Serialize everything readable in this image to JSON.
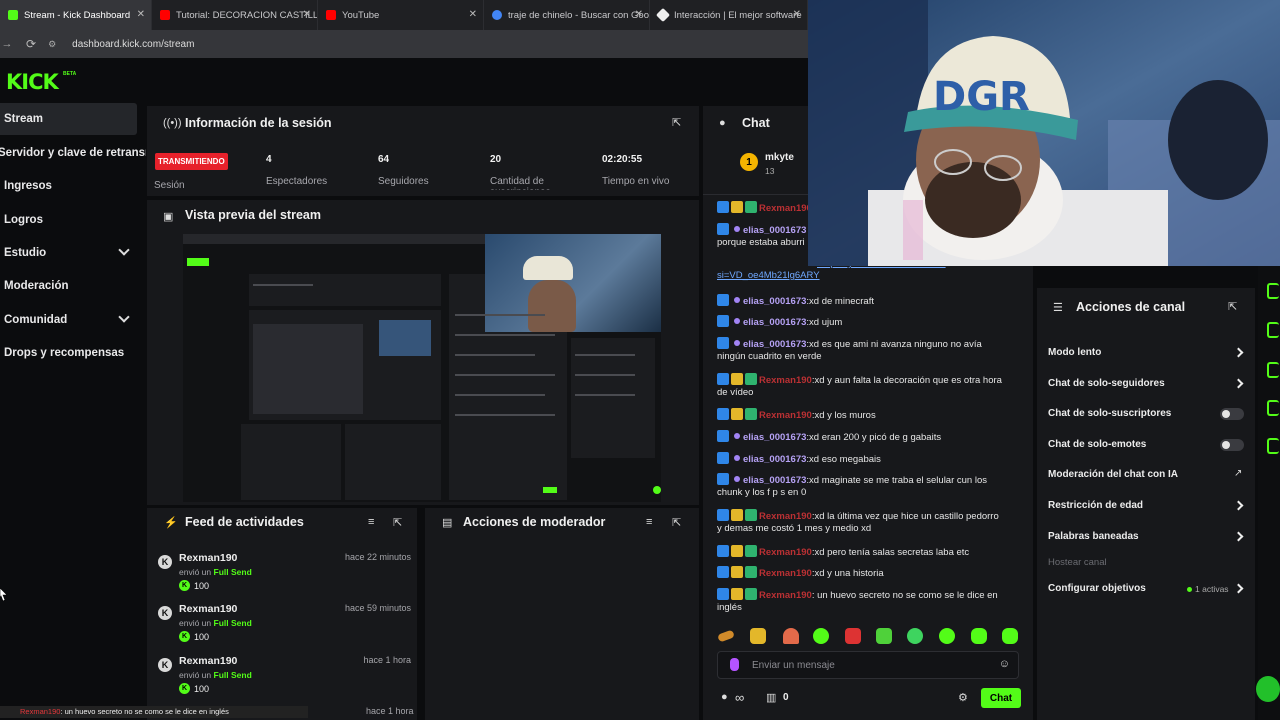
{
  "browser": {
    "tabs": [
      {
        "title": "Stream - Kick Dashboard",
        "active": true,
        "fav_color": "#53fc18"
      },
      {
        "title": "Tutorial: DECORACION CASTILLO",
        "active": false,
        "fav_color": "#ff0000"
      },
      {
        "title": "YouTube",
        "active": false,
        "fav_color": "#ff0000"
      },
      {
        "title": "traje de chinelo - Buscar con Google",
        "active": false,
        "fav_color": "#4285f4"
      },
      {
        "title": "Interacción | El mejor software",
        "active": false,
        "fav_color": "#ffffff"
      }
    ],
    "url": "dashboard.kick.com/stream"
  },
  "brand": {
    "logo": "KICK",
    "beta": "BETA",
    "accent": "#53fc18"
  },
  "sidebar": {
    "items": [
      {
        "label": "Stream",
        "active": true
      },
      {
        "label": "Servidor y clave de retransmisión"
      },
      {
        "label": "Ingresos"
      },
      {
        "label": "Logros"
      },
      {
        "label": "Estudio",
        "expandable": true
      },
      {
        "label": "Moderación"
      },
      {
        "label": "Comunidad",
        "expandable": true
      },
      {
        "label": "Drops y recompensas"
      }
    ]
  },
  "session": {
    "title": "Información de la sesión",
    "live_badge": "TRANSMITIENDO",
    "session_label": "Sesión",
    "stats": [
      {
        "value": "4",
        "label": "Espectadores"
      },
      {
        "value": "64",
        "label": "Seguidores"
      },
      {
        "value": "20",
        "label": "Cantidad de suscripciones"
      },
      {
        "value": "02:20:55",
        "label": "Tiempo en vivo"
      }
    ]
  },
  "preview": {
    "title": "Vista previa del stream"
  },
  "feed": {
    "title": "Feed de actividades",
    "items": [
      {
        "user": "Rexman190",
        "time": "hace 22 minutos",
        "action": "envió un",
        "gift": "Full Send",
        "amount": "100"
      },
      {
        "user": "Rexman190",
        "time": "hace 59 minutos",
        "action": "envió un",
        "gift": "Full Send",
        "amount": "100"
      },
      {
        "user": "Rexman190",
        "time": "hace 1 hora",
        "action": "envió un",
        "gift": "Full Send",
        "amount": "100"
      }
    ],
    "next_time": "hace 1 hora"
  },
  "mod_actions": {
    "title": "Acciones de moderador"
  },
  "chat": {
    "title": "Chat",
    "pinned_user": "mkyte",
    "pinned_count": "13",
    "messages": [
      {
        "user": "Rexman190",
        "type": "rex",
        "text": ""
      },
      {
        "user": "elias_0001673",
        "type": "elias",
        "text": "",
        "cont": "porque estaba aburri"
      },
      {
        "user": "",
        "type": "link",
        "text": ":https://youtube.com/watch?v=",
        "cont": "si=VD_oe4Mb21lg6ARY"
      },
      {
        "user": "elias_0001673",
        "type": "elias",
        "text": ":xd de minecraft"
      },
      {
        "user": "elias_0001673",
        "type": "elias",
        "text": ":xd ujum"
      },
      {
        "user": "elias_0001673",
        "type": "elias",
        "text": ":xd es que ami ni avanza ninguno no avía",
        "cont": "ningún cuadrito en verde"
      },
      {
        "user": "Rexman190",
        "type": "rex",
        "text": ":xd y aun falta la decoración que es otra hora",
        "cont": "de vídeo"
      },
      {
        "user": "Rexman190",
        "type": "rex",
        "text": ":xd y los muros"
      },
      {
        "user": "elias_0001673",
        "type": "elias",
        "text": ":xd eran 200 y picó de g gabaits"
      },
      {
        "user": "elias_0001673",
        "type": "elias",
        "text": ":xd eso megabais"
      },
      {
        "user": "elias_0001673",
        "type": "elias",
        "text": ":xd maginate se me traba el selular cun los",
        "cont": "chunk y los f p s en 0"
      },
      {
        "user": "Rexman190",
        "type": "rex",
        "text": ":xd la última vez que hice un castillo pedorro",
        "cont": "y demas me costó 1 mes y medio xd"
      },
      {
        "user": "Rexman190",
        "type": "rex",
        "text": ":xd pero tenía salas secretas laba etc"
      },
      {
        "user": "Rexman190",
        "type": "rex",
        "text": ":xd y una historia"
      },
      {
        "user": "Rexman190",
        "type": "rex",
        "text": ": un huevo secreto no se como se le dice en",
        "cont": "inglés"
      }
    ],
    "input_placeholder": "Enviar un mensaje",
    "viewer_count": "0",
    "infinity": "∞",
    "send_label": "Chat"
  },
  "channel_actions": {
    "title": "Acciones de canal",
    "items": [
      {
        "label": "Modo lento",
        "control": "chevron"
      },
      {
        "label": "Chat de solo-seguidores",
        "control": "chevron"
      },
      {
        "label": "Chat de solo-suscriptores",
        "control": "toggle"
      },
      {
        "label": "Chat de solo-emotes",
        "control": "toggle"
      },
      {
        "label": "Moderación del chat con IA",
        "control": "external"
      },
      {
        "label": "Restricción de edad",
        "control": "chevron"
      },
      {
        "label": "Palabras baneadas",
        "control": "chevron"
      },
      {
        "label": "Hostear canal",
        "control": "none",
        "disabled": true
      },
      {
        "label": "Configurar objetivos",
        "control": "chevron",
        "extra": "1 activas"
      }
    ]
  },
  "overlay": {
    "user": "Rexman190",
    "text": ": un huevo secreto no se como se le dice en inglés"
  }
}
